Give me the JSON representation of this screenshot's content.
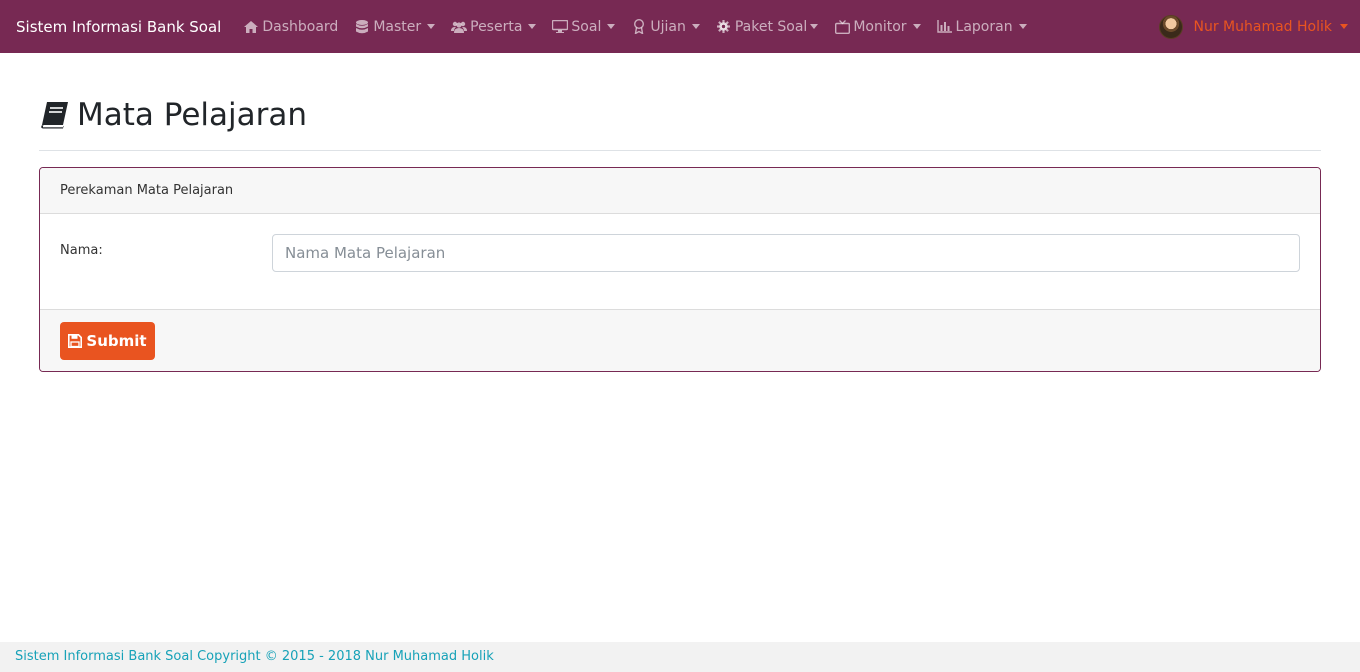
{
  "app": {
    "brand": "Sistem Informasi Bank Soal"
  },
  "nav": {
    "items": [
      {
        "label": "Dashboard",
        "icon": "home-icon",
        "dropdown": false
      },
      {
        "label": "Master",
        "icon": "database-icon",
        "dropdown": true
      },
      {
        "label": "Peserta",
        "icon": "users-icon",
        "dropdown": true
      },
      {
        "label": "Soal",
        "icon": "desktop-icon",
        "dropdown": true
      },
      {
        "label": "Ujian",
        "icon": "award-icon",
        "dropdown": true
      },
      {
        "label": "Paket Soal",
        "icon": "gear-icon",
        "dropdown": true
      },
      {
        "label": "Monitor",
        "icon": "tv-icon",
        "dropdown": true
      },
      {
        "label": "Laporan",
        "icon": "bar-chart-icon",
        "dropdown": true
      }
    ],
    "user": {
      "name": "Nur Muhamad Holik",
      "avatar_icon": "user-avatar"
    }
  },
  "page": {
    "title": "Mata Pelajaran",
    "title_icon": "book-icon"
  },
  "card": {
    "header": "Perekaman Mata Pelajaran",
    "form": {
      "name_label": "Nama:",
      "name_value": "",
      "name_placeholder": "Nama Mata Pelajaran"
    },
    "submit_label": "Submit"
  },
  "footer": {
    "text": "Sistem Informasi Bank Soal Copyright © 2015 - 2018 Nur Muhamad Holik"
  },
  "colors": {
    "navbar": "#772953",
    "accent": "#e95420",
    "footer_text": "#17a2b8"
  }
}
